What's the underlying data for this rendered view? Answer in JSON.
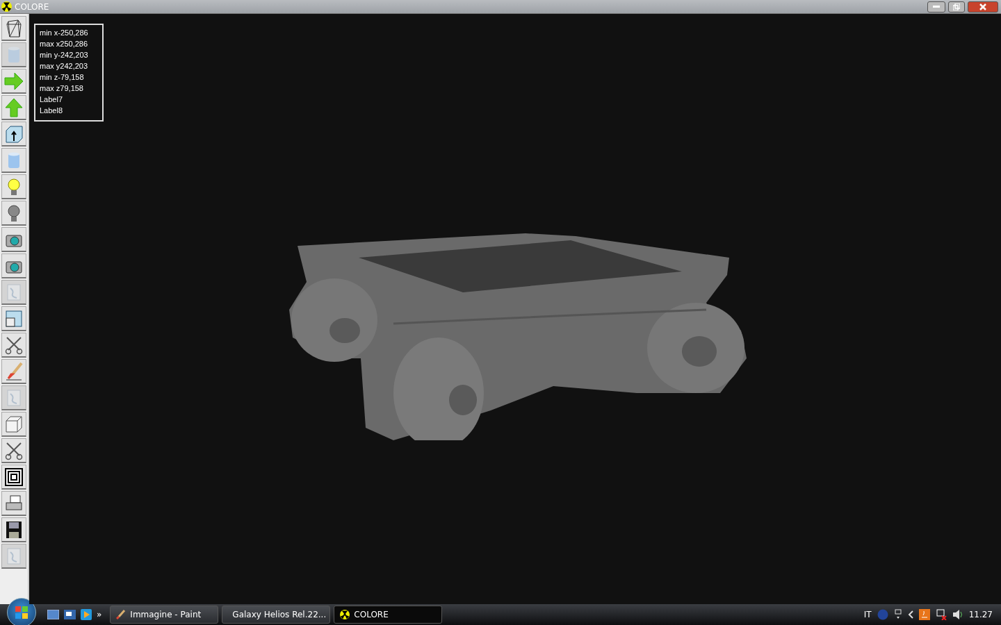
{
  "window": {
    "title": "COLORE"
  },
  "tools": [
    {
      "kind": "wireframe",
      "disabled": false
    },
    {
      "kind": "cylinder",
      "disabled": true
    },
    {
      "kind": "arrow-right",
      "disabled": false
    },
    {
      "kind": "arrow-up",
      "disabled": false
    },
    {
      "kind": "cube-arrow",
      "disabled": false
    },
    {
      "kind": "cylinder",
      "disabled": false
    },
    {
      "kind": "bulb-on",
      "disabled": false
    },
    {
      "kind": "bulb-off",
      "disabled": false
    },
    {
      "kind": "camera",
      "disabled": false
    },
    {
      "kind": "camera",
      "disabled": false
    },
    {
      "kind": "texture",
      "disabled": true
    },
    {
      "kind": "window",
      "disabled": false
    },
    {
      "kind": "scissors",
      "disabled": false
    },
    {
      "kind": "brush",
      "disabled": false
    },
    {
      "kind": "texture",
      "disabled": true
    },
    {
      "kind": "cube",
      "disabled": false
    },
    {
      "kind": "scissors",
      "disabled": false
    },
    {
      "kind": "squares",
      "disabled": false
    },
    {
      "kind": "printer",
      "disabled": false
    },
    {
      "kind": "floppy",
      "disabled": false
    },
    {
      "kind": "texture",
      "disabled": true
    }
  ],
  "info_labels": [
    "min x-250,286",
    "max x250,286",
    "min y-242,203",
    "max y242,203",
    "min z-79,158",
    "max z79,158",
    "Label7",
    "Label8"
  ],
  "taskbar": {
    "overflow": "»",
    "tasks": [
      {
        "label": "Immagine - Paint",
        "kind": "paint",
        "selected": false
      },
      {
        "label": "Galaxy Helios  Rel.22...",
        "kind": "window",
        "selected": false
      },
      {
        "label": "COLORE",
        "kind": "radiation",
        "selected": true
      }
    ],
    "language": "IT",
    "clock": "11.27"
  }
}
